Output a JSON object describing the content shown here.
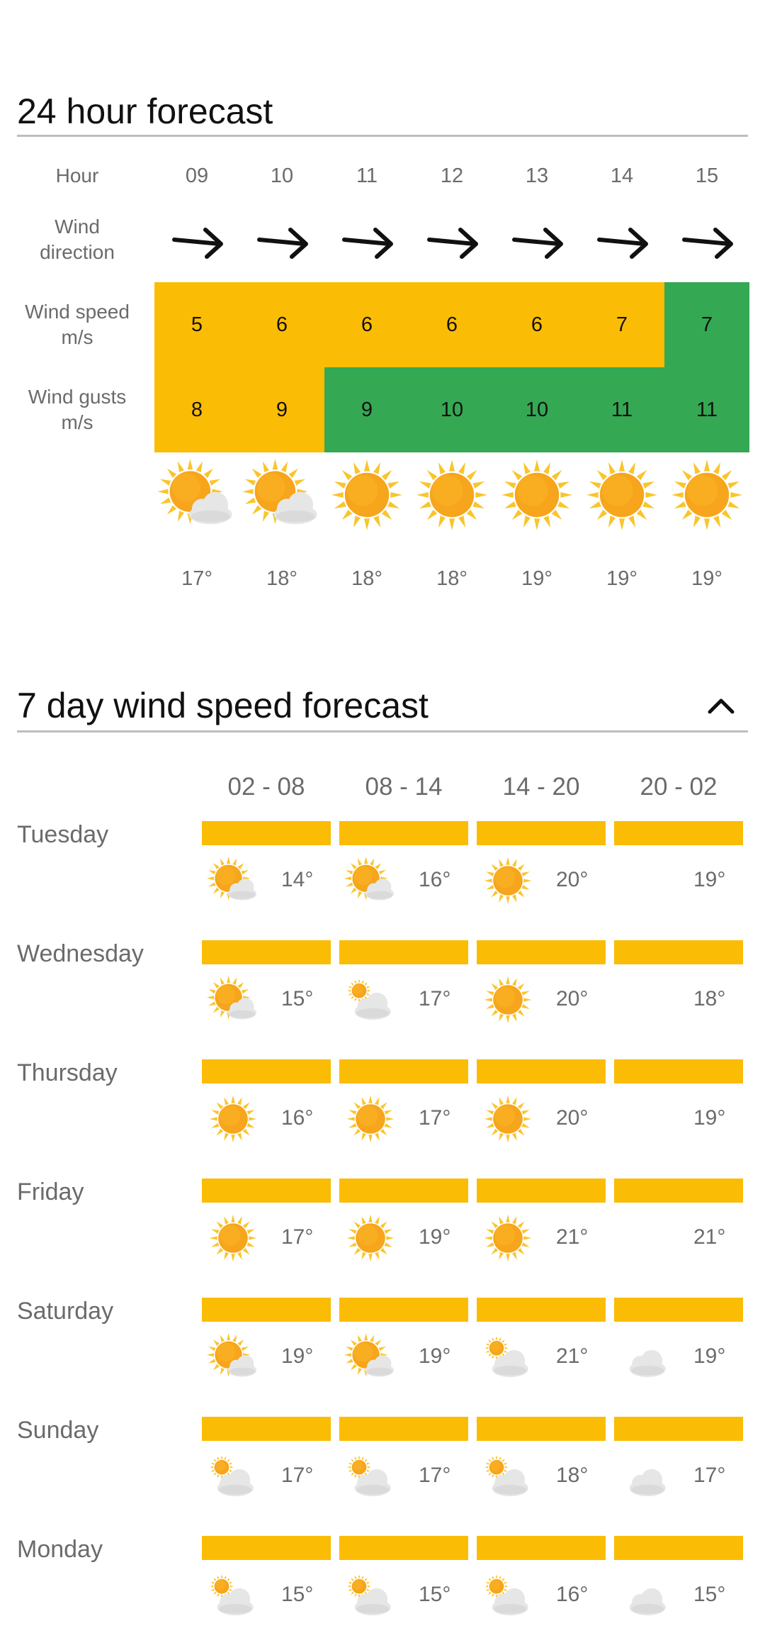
{
  "hourly": {
    "title": "24 hour forecast",
    "labels": {
      "hour": "Hour",
      "wind_direction": [
        "Wind",
        "direction"
      ],
      "wind_speed": [
        "Wind speed",
        "m/s"
      ],
      "wind_gusts": [
        "Wind gusts",
        "m/s"
      ]
    },
    "hours": [
      {
        "hour": "09",
        "speed": "5",
        "gusts": "8",
        "temp": "17°",
        "icon": "partly-cloudy-icon",
        "speed_level": "moderate",
        "gust_level": "moderate"
      },
      {
        "hour": "10",
        "speed": "6",
        "gusts": "9",
        "temp": "18°",
        "icon": "partly-cloudy-icon",
        "speed_level": "moderate",
        "gust_level": "moderate"
      },
      {
        "hour": "11",
        "speed": "6",
        "gusts": "9",
        "temp": "18°",
        "icon": "sun-icon",
        "speed_level": "moderate",
        "gust_level": "low"
      },
      {
        "hour": "12",
        "speed": "6",
        "gusts": "10",
        "temp": "18°",
        "icon": "sun-icon",
        "speed_level": "moderate",
        "gust_level": "low"
      },
      {
        "hour": "13",
        "speed": "6",
        "gusts": "10",
        "temp": "19°",
        "icon": "sun-icon",
        "speed_level": "moderate",
        "gust_level": "low"
      },
      {
        "hour": "14",
        "speed": "7",
        "gusts": "11",
        "temp": "19°",
        "icon": "sun-icon",
        "speed_level": "moderate",
        "gust_level": "low"
      },
      {
        "hour": "15",
        "speed": "7",
        "gusts": "11",
        "temp": "19°",
        "icon": "sun-icon",
        "speed_level": "low",
        "gust_level": "low"
      }
    ]
  },
  "weekly": {
    "title": "7 day wind speed forecast",
    "collapse_icon": "chevron-up-icon",
    "periods": [
      "02 - 08",
      "08 - 14",
      "14 - 20",
      "20 - 02"
    ],
    "days": [
      {
        "name": "Tuesday",
        "cells": [
          {
            "icon": "partly-cloudy-icon",
            "temp": "14°"
          },
          {
            "icon": "partly-cloudy-icon",
            "temp": "16°"
          },
          {
            "icon": "sun-icon",
            "temp": "20°"
          },
          {
            "icon": "moon-icon",
            "temp": "19°"
          }
        ]
      },
      {
        "name": "Wednesday",
        "cells": [
          {
            "icon": "partly-cloudy-icon",
            "temp": "15°"
          },
          {
            "icon": "cloudy-sun-icon",
            "temp": "17°"
          },
          {
            "icon": "sun-icon",
            "temp": "20°"
          },
          {
            "icon": "moon-icon",
            "temp": "18°"
          }
        ]
      },
      {
        "name": "Thursday",
        "cells": [
          {
            "icon": "sun-icon",
            "temp": "16°"
          },
          {
            "icon": "sun-icon",
            "temp": "17°"
          },
          {
            "icon": "sun-icon",
            "temp": "20°"
          },
          {
            "icon": "moon-icon",
            "temp": "19°"
          }
        ]
      },
      {
        "name": "Friday",
        "cells": [
          {
            "icon": "sun-icon",
            "temp": "17°"
          },
          {
            "icon": "sun-icon",
            "temp": "19°"
          },
          {
            "icon": "sun-icon",
            "temp": "21°"
          },
          {
            "icon": "moon-icon",
            "temp": "21°"
          }
        ]
      },
      {
        "name": "Saturday",
        "cells": [
          {
            "icon": "partly-cloudy-icon",
            "temp": "19°"
          },
          {
            "icon": "partly-cloudy-icon",
            "temp": "19°"
          },
          {
            "icon": "cloudy-sun-icon",
            "temp": "21°"
          },
          {
            "icon": "cloudy-moon-icon",
            "temp": "19°"
          }
        ]
      },
      {
        "name": "Sunday",
        "cells": [
          {
            "icon": "cloudy-sun-icon",
            "temp": "17°"
          },
          {
            "icon": "cloudy-sun-icon",
            "temp": "17°"
          },
          {
            "icon": "cloudy-sun-icon",
            "temp": "18°"
          },
          {
            "icon": "cloudy-moon-icon",
            "temp": "17°"
          }
        ]
      },
      {
        "name": "Monday",
        "cells": [
          {
            "icon": "cloudy-sun-icon",
            "temp": "15°"
          },
          {
            "icon": "cloudy-sun-icon",
            "temp": "15°"
          },
          {
            "icon": "cloudy-sun-icon",
            "temp": "16°"
          },
          {
            "icon": "cloudy-moon-icon",
            "temp": "15°"
          }
        ]
      }
    ]
  },
  "colors": {
    "moderate": "#fbbc05",
    "low": "#34a853",
    "bar": "#fbbc05",
    "moon": "#6f7378"
  }
}
